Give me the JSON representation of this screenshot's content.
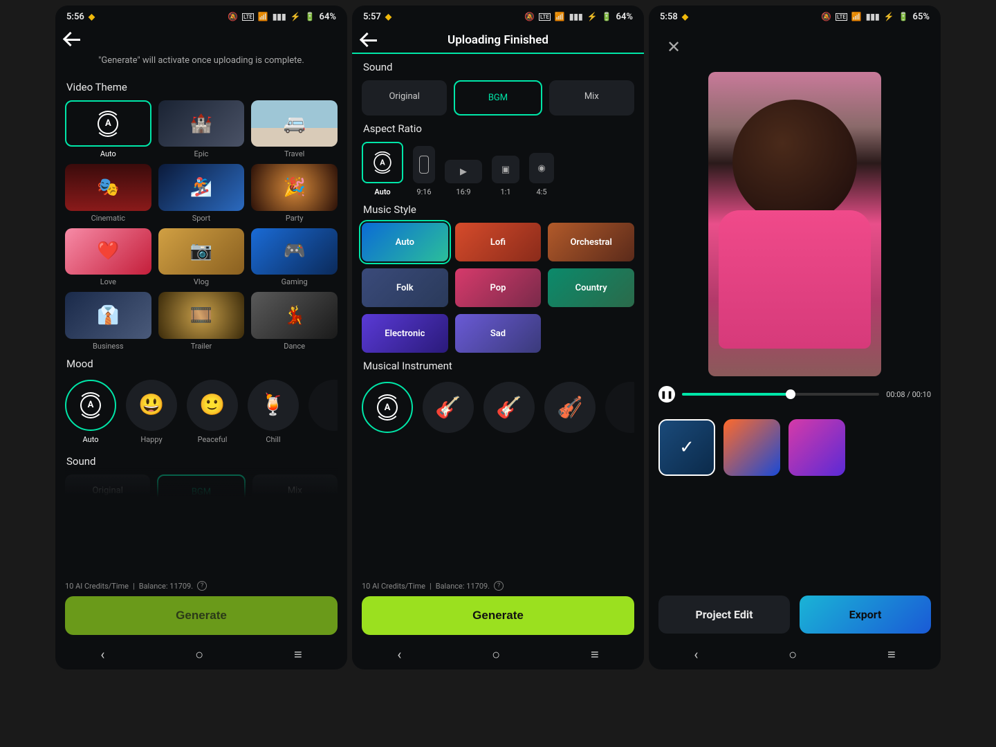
{
  "status": {
    "s1_time": "5:56",
    "s2_time": "5:57",
    "s3_time": "5:58",
    "battery12": "64%",
    "battery3": "65%"
  },
  "screen1": {
    "hint": "\"Generate\" will activate once uploading is complete.",
    "video_theme_title": "Video Theme",
    "themes": [
      {
        "label": "Auto"
      },
      {
        "label": "Epic"
      },
      {
        "label": "Travel"
      },
      {
        "label": "Cinematic"
      },
      {
        "label": "Sport"
      },
      {
        "label": "Party"
      },
      {
        "label": "Love"
      },
      {
        "label": "Vlog"
      },
      {
        "label": "Gaming"
      },
      {
        "label": "Business"
      },
      {
        "label": "Trailer"
      },
      {
        "label": "Dance"
      }
    ],
    "mood_title": "Mood",
    "moods": [
      {
        "label": "Auto"
      },
      {
        "label": "Happy"
      },
      {
        "label": "Peaceful"
      },
      {
        "label": "Chill"
      }
    ],
    "sound_title": "Sound",
    "sound_opts": {
      "original": "Original",
      "bgm": "BGM",
      "mix": "Mix"
    },
    "credits_a": "10 AI Credits/Time",
    "credits_sep": "|",
    "credits_b": "Balance: 11709.",
    "generate": "Generate"
  },
  "screen2": {
    "title": "Uploading Finished",
    "sound_title": "Sound",
    "sound_opts": {
      "original": "Original",
      "bgm": "BGM",
      "mix": "Mix"
    },
    "aspect_title": "Aspect Ratio",
    "aspects": [
      {
        "label": "Auto"
      },
      {
        "label": "9:16"
      },
      {
        "label": "16:9"
      },
      {
        "label": "1:1"
      },
      {
        "label": "4:5"
      }
    ],
    "music_title": "Music Style",
    "music": [
      {
        "label": "Auto"
      },
      {
        "label": "Lofi"
      },
      {
        "label": "Orchestral"
      },
      {
        "label": "Folk"
      },
      {
        "label": "Pop"
      },
      {
        "label": "Country"
      },
      {
        "label": "Electronic"
      },
      {
        "label": "Sad"
      }
    ],
    "instrument_title": "Musical Instrument",
    "credits_a": "10 AI Credits/Time",
    "credits_sep": "|",
    "credits_b": "Balance: 11709.",
    "generate": "Generate"
  },
  "screen3": {
    "time": "00:08 / 00:10",
    "project_edit": "Project Edit",
    "export": "Export"
  },
  "colors": {
    "accent": "#00e6a8",
    "gen": "#9be01f"
  }
}
